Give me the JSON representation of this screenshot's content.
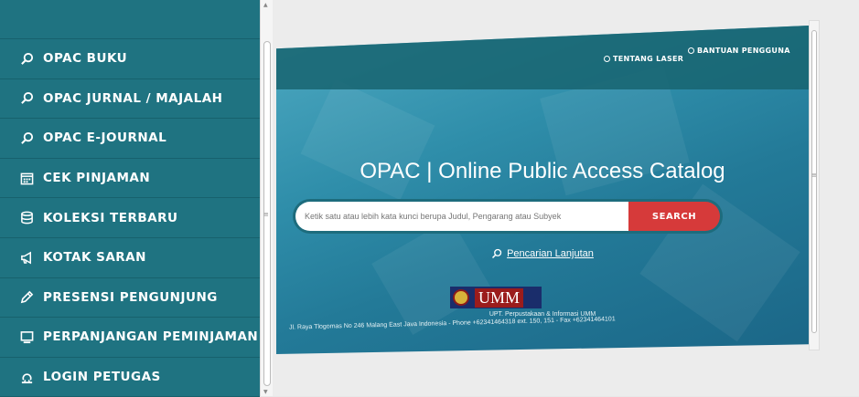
{
  "sidebar": {
    "items": [
      {
        "label": "OPAC BUKU",
        "icon": "search-icon"
      },
      {
        "label": "OPAC JURNAL / MAJALAH",
        "icon": "search-icon"
      },
      {
        "label": "OPAC E-JOURNAL",
        "icon": "search-icon"
      },
      {
        "label": "CEK PINJAMAN",
        "icon": "calendar-icon"
      },
      {
        "label": "KOLEKSI TERBARU",
        "icon": "database-icon"
      },
      {
        "label": "KOTAK SARAN",
        "icon": "megaphone-icon"
      },
      {
        "label": "PRESENSI PENGUNJUNG",
        "icon": "pencil-icon"
      },
      {
        "label": "PERPANJANGAN PEMINJAMAN",
        "icon": "monitor-icon"
      },
      {
        "label": "LOGIN PETUGAS",
        "icon": "user-icon"
      }
    ]
  },
  "header": {
    "about_label": "TENTANG LASER",
    "help_label": "BANTUAN PENGGUNA"
  },
  "main": {
    "title": "OPAC | Online Public Access Catalog",
    "search": {
      "placeholder": "Ketik satu atau lebih kata kunci berupa Judul, Pengarang atau Subyek",
      "value": "",
      "button_label": "SEARCH"
    },
    "advanced_search_label": "Pencarian Lanjutan",
    "logo_text": "UMM",
    "address_line1": "UPT. Perpustakaan & Informasi UMM",
    "address_line2": "Jl. Raya Tlogomas No 246 Malang East Java Indonesia - Phone +62341464318 ext. 150, 151 - Fax +62341464101"
  },
  "colors": {
    "sidebar_bg": "#1f7381",
    "search_button": "#d63a3a",
    "banner": "#2f8eaa"
  }
}
